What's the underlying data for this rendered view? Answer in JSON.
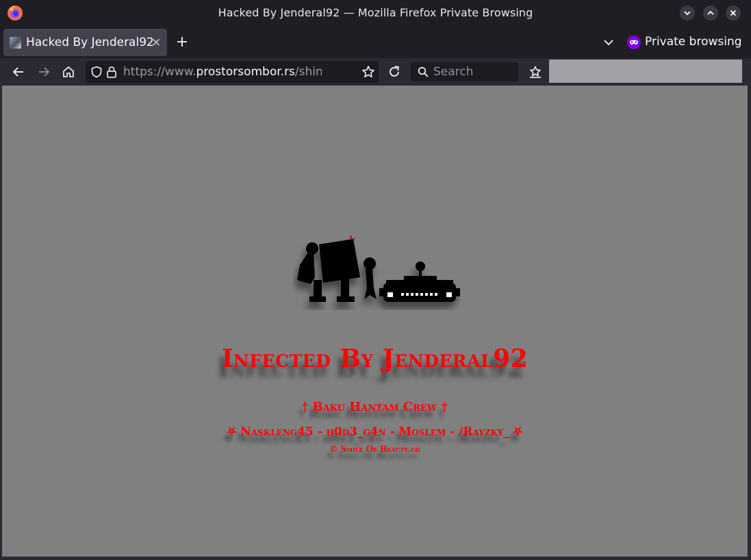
{
  "window": {
    "title": "Hacked By Jenderal92 — Mozilla Firefox Private Browsing"
  },
  "tabs": {
    "active_title": "Hacked By Jenderal92",
    "close_glyph": "×",
    "private_label": "Private browsing"
  },
  "navbar": {
    "url_prefix": "https://www.",
    "url_domain": "prostorsombor.rs",
    "url_path": "/shin.htm",
    "search_placeholder": "Search"
  },
  "page": {
    "headline": "Infected By Jenderal92",
    "crew": "† Baku Hantam Crew †",
    "members": "⛧ Naskleng45 - h0d3_g4n - Moslem - /Rayzky_ ⛧",
    "credit": "© Smile Of Beauty.co"
  },
  "colors": {
    "accent_red": "#ff0000",
    "page_bg": "#808080",
    "chrome_dark": "#1f1e25",
    "private_purple": "#8000d7"
  },
  "icons": [
    "firefox-logo-icon",
    "minimize-icon",
    "maximize-icon",
    "close-icon",
    "tab-favicon-icon",
    "tab-close-icon",
    "new-tab-icon",
    "tab-list-icon",
    "private-browsing-icon",
    "back-icon",
    "forward-icon",
    "home-icon",
    "tracking-shield-icon",
    "lock-icon",
    "bookmark-star-icon",
    "reload-icon",
    "search-icon",
    "bookmarks-menu-icon",
    "robot-icon",
    "rover-icon"
  ]
}
